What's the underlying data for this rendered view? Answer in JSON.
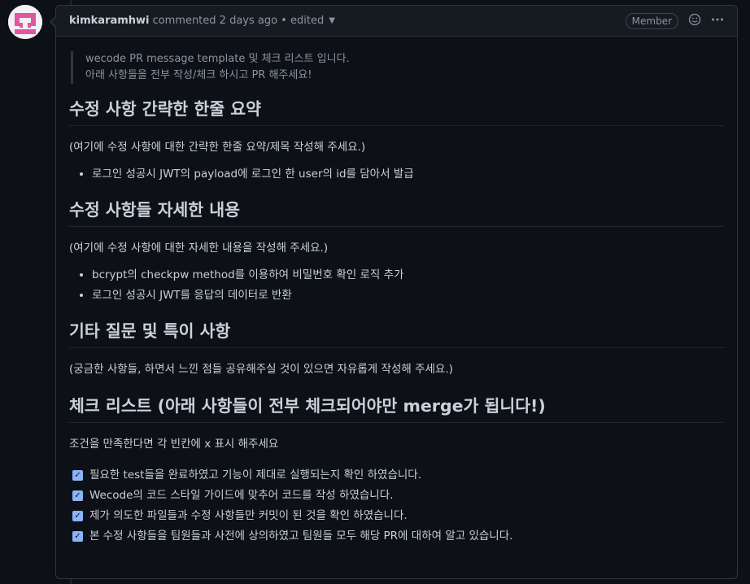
{
  "header": {
    "author": "kimkaramhwi",
    "meta": "commented 2 days ago • edited",
    "badge": "Member"
  },
  "quote": [
    "wecode PR message template 및 체크 리스트 입니다.",
    "아래 사항들을 전부 작성/체크 하시고 PR 해주세요!"
  ],
  "sections": {
    "s1": {
      "heading": "수정 사항 간략한 한줄 요약",
      "desc": "(여기에 수정 사항에 대한 간략한 한줄 요약/제목 작성해 주세요.)",
      "items": [
        "로그인 성공시 JWT의 payload에 로그인 한 user의 id를 담아서 발급"
      ]
    },
    "s2": {
      "heading": "수정 사항들 자세한 내용",
      "desc": "(여기에 수정 사항에 대한 자세한 내용을 작성해 주세요.)",
      "items": [
        "bcrypt의 checkpw method를 이용하여 비밀번호 확인 로직 추가",
        "로그인 성공시 JWT를 응답의 데이터로 반환"
      ]
    },
    "s3": {
      "heading": "기타 질문 및 특이 사항",
      "desc": "(궁금한 사항들, 하면서 느낀 점들 공유해주실 것이 있으면 자유롭게 작성해 주세요.)"
    },
    "s4": {
      "heading": "체크 리스트 (아래 사항들이 전부 체크되어야만 merge가 됩니다!)",
      "desc": "조건을 만족한다면 각 빈칸에 x 표시 해주세요",
      "tasks": [
        "필요한 test들을 완료하였고 기능이 제대로 실행되는지 확인 하였습니다.",
        "Wecode의 코드 스타일 가이드에 맞추어 코드를 작성 하였습니다.",
        "제가 의도한 파일들과 수정 사항들만 커밋이 된 것을 확인 하였습니다.",
        "본 수정 사항들을 팀원들과 사전에 상의하였고 팀원들 모두 해당 PR에 대하여 알고 있습니다."
      ]
    }
  },
  "colors": {
    "background": "#0d1117",
    "header_bg": "#161b22",
    "border": "#30363d",
    "checkbox": "#8ab4f8",
    "avatar_pink": "#e0569f"
  },
  "icons": [
    "avatar-identicon",
    "caret-down-icon",
    "smiley-icon",
    "kebab-icon",
    "checkbox-checked-icon"
  ]
}
